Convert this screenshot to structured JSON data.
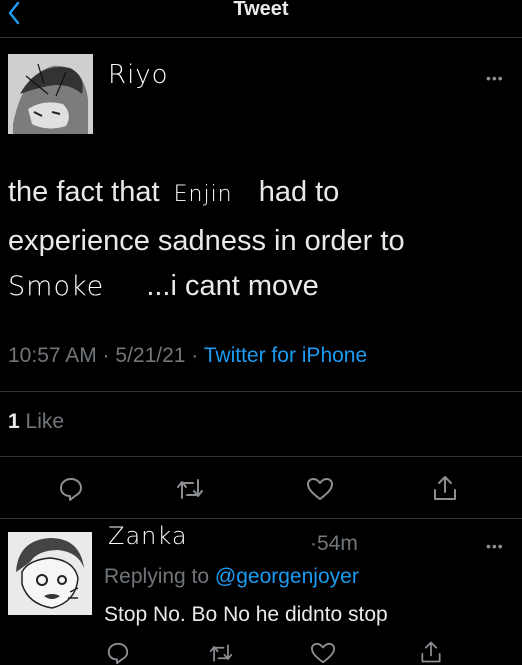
{
  "header": {
    "title": "Tweet"
  },
  "tweet": {
    "author": "Riyo",
    "text_line1_a": "the fact that",
    "text_handwritten_1": "Enjin",
    "text_line1_b": "had to",
    "text_line2": "experience sadness in order to",
    "text_handwritten_2": "Smoke",
    "text_line3_b": "...i cant move",
    "timestamp": "10:57 AM · 5/21/21 · ",
    "source": "Twitter for iPhone",
    "like_count": "1",
    "like_label": "Like"
  },
  "reply": {
    "author": "Zanka",
    "time": "·54m",
    "replying_prefix": "Replying to ",
    "replying_handle": "@georgenjoyer",
    "text": "Stop No. Bo No he didnto stop"
  },
  "colors": {
    "accent": "#1d9bf0",
    "muted": "#71767b",
    "text": "#e7e9ea",
    "background": "#000000"
  },
  "icons": [
    "back-chevron-icon",
    "more-icon",
    "reply-icon",
    "retweet-icon",
    "like-icon",
    "share-icon"
  ]
}
